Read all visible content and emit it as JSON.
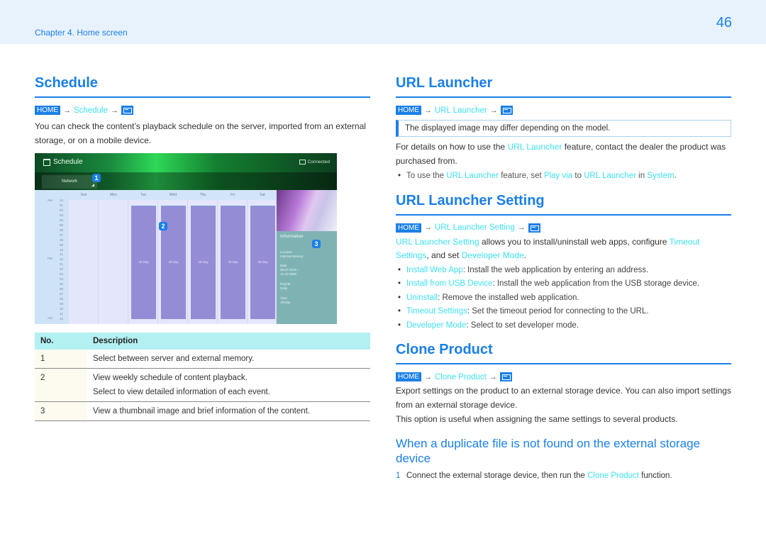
{
  "header": {
    "chapter": "Chapter 4. Home screen",
    "page_number": "46"
  },
  "path_common": {
    "home_badge": "HOME",
    "arrow": "→"
  },
  "schedule": {
    "title": "Schedule",
    "path_item": "Schedule",
    "intro": "You can check the content’s playback schedule on the server, imported from an external storage, or on a mobile device.",
    "screenshot": {
      "app_title": "Schedule",
      "connection_status": "Connected",
      "source_button": "Network",
      "markers": [
        "1",
        "2",
        "3"
      ],
      "days": [
        "Sun",
        "Mon",
        "Tue",
        "Wed",
        "Thu",
        "Fri",
        "Sat"
      ],
      "time_labels": {
        "am_top": "AM",
        "pm": "PM",
        "am_bottom": "AM",
        "hours": [
          "12",
          "01",
          "02",
          "03",
          "04",
          "05",
          "06",
          "07",
          "08",
          "09",
          "10",
          "11",
          "12",
          "01",
          "02",
          "03",
          "04",
          "05",
          "06",
          "07",
          "08",
          "09",
          "10",
          "11",
          "12"
        ]
      },
      "events": [
        {
          "day": "Tue",
          "label": "All Day"
        },
        {
          "day": "Wed",
          "label": "All Day"
        },
        {
          "day": "Thu",
          "label": "All Day"
        },
        {
          "day": "Fri",
          "label": "All Day"
        },
        {
          "day": "Sat",
          "label": "All Day"
        }
      ],
      "info_panel": {
        "title": "Information",
        "location_label": "Location",
        "location_value": "Internal Memory",
        "date_label": "Date",
        "date_value_1": "09-07-2016 ~",
        "date_value_2": "12-31-2999",
        "repeat_label": "Repeat",
        "repeat_value": "Daily",
        "time_label": "Time",
        "time_value": "All Day"
      }
    },
    "table": {
      "headers": [
        "No.",
        "Description"
      ],
      "rows": [
        {
          "no": "1",
          "lines": [
            "Select between server and external memory."
          ]
        },
        {
          "no": "2",
          "lines": [
            "View weekly schedule of content playback.",
            "Select to view detailed information of each event."
          ]
        },
        {
          "no": "3",
          "lines": [
            "View a thumbnail image and brief information of the content."
          ]
        }
      ]
    }
  },
  "url_launcher": {
    "title": "URL Launcher",
    "path_item": "URL Launcher",
    "note": "The displayed image may differ depending on the model.",
    "para": {
      "t1": "For details on how to use the ",
      "l1": "URL Launcher",
      "t2": " feature, contact the dealer the product was purchased from."
    },
    "bullet": {
      "t1": "To use the ",
      "l1": "URL Launcher",
      "t2": " feature, set ",
      "l2": "Play via",
      "t3": " to ",
      "l3": "URL Launcher",
      "t4": " in ",
      "l4": "System",
      "t5": "."
    }
  },
  "url_launcher_setting": {
    "title": "URL Launcher Setting",
    "path_item": "URL Launcher Setting",
    "para": {
      "l1": "URL Launcher Setting",
      "t1": " allows you to install/uninstall web apps, configure ",
      "l2": "Timeout Settings",
      "t2": ", and set ",
      "l3": "Developer Mode",
      "t3": "."
    },
    "bullets": [
      {
        "term": "Install Web App",
        "desc": ": Install the web application by entering an address."
      },
      {
        "term": "Install from USB Device",
        "desc": ": Install the web application from the USB storage device."
      },
      {
        "term": "Uninstall",
        "desc": ": Remove the installed web application."
      },
      {
        "term": "Timeout Settings",
        "desc": ": Set the timeout period for connecting to the URL."
      },
      {
        "term": "Developer Mode",
        "desc": ": Select to set developer mode."
      }
    ]
  },
  "clone_product": {
    "title": "Clone Product",
    "path_item": "Clone Product",
    "para1": "Export settings on the product to an external storage device. You can also import settings from an external storage device.",
    "para2": "This option is useful when assigning the same settings to several products.",
    "subtitle": "When a duplicate file is not found on the external storage device",
    "step": {
      "num": "1",
      "t1": "Connect the external storage device, then run the ",
      "l1": "Clone Product",
      "t2": " function."
    }
  }
}
